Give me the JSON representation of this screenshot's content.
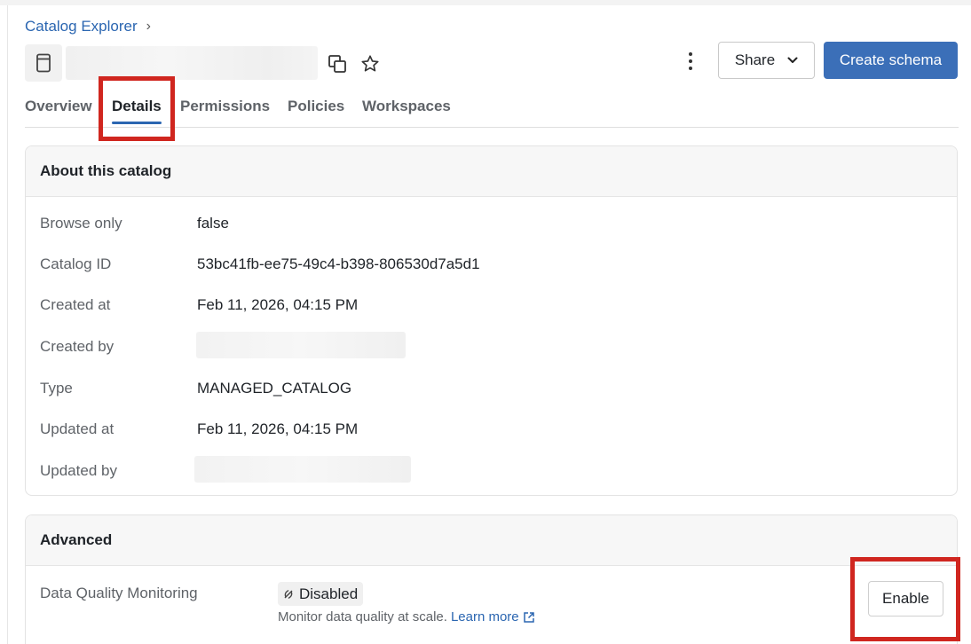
{
  "breadcrumb": {
    "root": "Catalog Explorer"
  },
  "header": {
    "catalog_name": "",
    "share_label": "Share",
    "create_label": "Create schema"
  },
  "tabs": [
    {
      "label": "Overview",
      "active": false
    },
    {
      "label": "Details",
      "active": true
    },
    {
      "label": "Permissions",
      "active": false
    },
    {
      "label": "Policies",
      "active": false
    },
    {
      "label": "Workspaces",
      "active": false
    }
  ],
  "about": {
    "title": "About this catalog",
    "rows": [
      {
        "label": "Browse only",
        "value": "false"
      },
      {
        "label": "Catalog ID",
        "value": "53bc41fb-ee75-49c4-b398-806530d7a5d1"
      },
      {
        "label": "Created at",
        "value": "Feb 11, 2026, 04:15 PM"
      },
      {
        "label": "Created by",
        "value": ""
      },
      {
        "label": "Type",
        "value": "MANAGED_CATALOG"
      },
      {
        "label": "Updated at",
        "value": "Feb 11, 2026, 04:15 PM"
      },
      {
        "label": "Updated by",
        "value": ""
      }
    ]
  },
  "advanced": {
    "title": "Advanced",
    "dqm_label": "Data Quality Monitoring",
    "status": "Disabled",
    "description": "Monitor data quality at scale.",
    "learn_more": "Learn more",
    "enable_label": "Enable"
  },
  "colors": {
    "accent": "#3b6fb8",
    "link": "#2b66b1",
    "highlight": "#d0261f"
  }
}
